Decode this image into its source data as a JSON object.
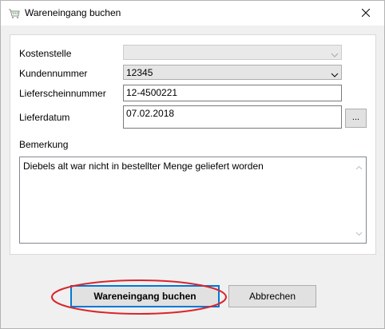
{
  "window": {
    "title": "Wareneingang buchen",
    "icon": "cart-icon",
    "close_icon": "close-icon"
  },
  "form": {
    "kostenstelle": {
      "label": "Kostenstelle",
      "value": "",
      "disabled": true
    },
    "kundennummer": {
      "label": "Kundennummer",
      "value": "12345"
    },
    "lieferscheinnummer": {
      "label": "Lieferscheinnummer",
      "value": "12-4500221"
    },
    "lieferdatum": {
      "label": "Lieferdatum",
      "value": "07.02.2018",
      "picker_label": "..."
    },
    "bemerkung": {
      "label": "Bemerkung",
      "value": "Diebels alt war nicht in bestellter Menge geliefert worden"
    }
  },
  "buttons": {
    "book": "Wareneingang buchen",
    "cancel": "Abbrechen"
  },
  "colors": {
    "highlight_ellipse": "#d9252b",
    "focus_border": "#0078d7"
  }
}
